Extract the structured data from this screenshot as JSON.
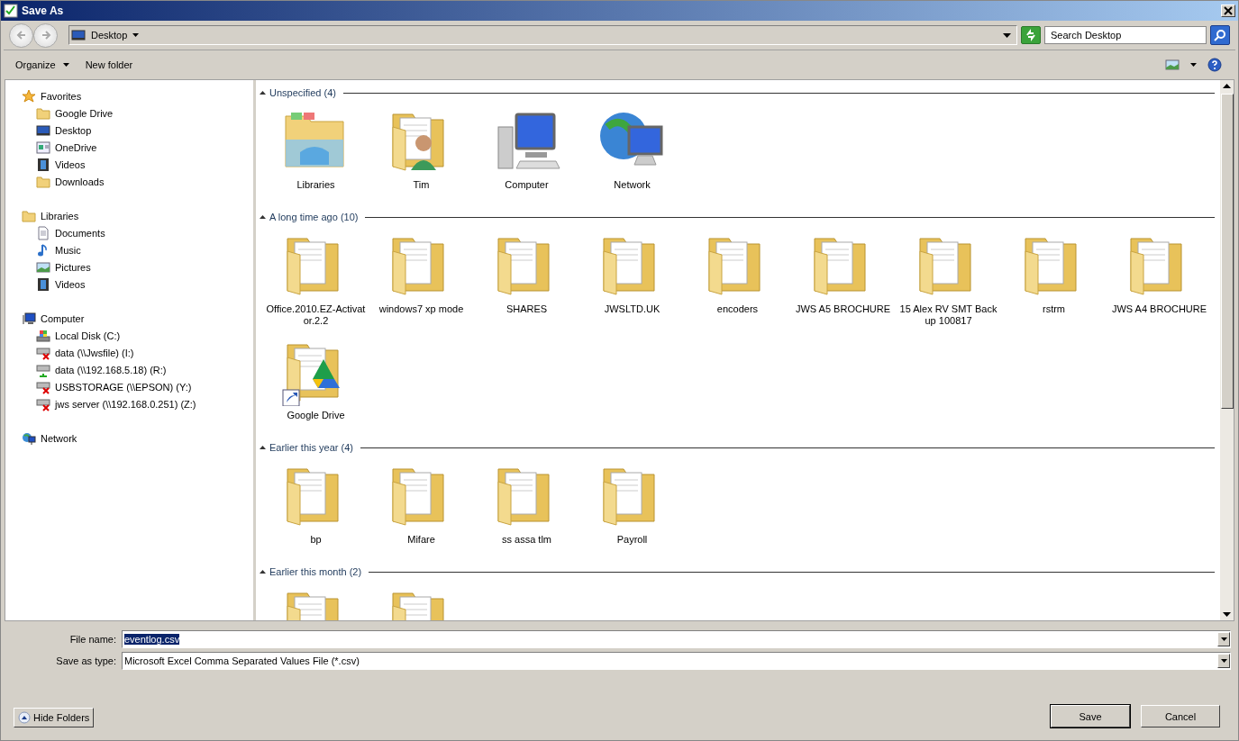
{
  "window": {
    "title": "Save As"
  },
  "address": {
    "location": "Desktop"
  },
  "search": {
    "placeholder": "Search Desktop"
  },
  "toolbar": {
    "organize": "Organize",
    "new_folder": "New folder"
  },
  "sidebar": {
    "groups": [
      {
        "label": "Favorites",
        "kind": "star",
        "children": [
          {
            "label": "Google Drive",
            "kind": "folder"
          },
          {
            "label": "Desktop",
            "kind": "monitor"
          },
          {
            "label": "OneDrive",
            "kind": "window"
          },
          {
            "label": "Videos",
            "kind": "film"
          },
          {
            "label": "Downloads",
            "kind": "folder"
          }
        ]
      },
      {
        "label": "Libraries",
        "kind": "folder",
        "children": [
          {
            "label": "Documents",
            "kind": "doc"
          },
          {
            "label": "Music",
            "kind": "music"
          },
          {
            "label": "Pictures",
            "kind": "picture"
          },
          {
            "label": "Videos",
            "kind": "film"
          }
        ]
      },
      {
        "label": "Computer",
        "kind": "computer",
        "children": [
          {
            "label": "Local Disk (C:)",
            "kind": "disk"
          },
          {
            "label": "data (\\\\Jwsfile) (I:)",
            "kind": "netdrive",
            "disconnected": true
          },
          {
            "label": "data (\\\\192.168.5.18) (R:)",
            "kind": "netdrive",
            "disconnected": false
          },
          {
            "label": "USBSTORAGE (\\\\EPSON) (Y:)",
            "kind": "netdrive",
            "disconnected": true
          },
          {
            "label": "jws server (\\\\192.168.0.251) (Z:)",
            "kind": "netdrive",
            "disconnected": true
          }
        ]
      },
      {
        "label": "Network",
        "kind": "network"
      }
    ]
  },
  "groups": [
    {
      "header": "Unspecified (4)",
      "items": [
        {
          "label": "Libraries",
          "kind": "libraries"
        },
        {
          "label": "Tim",
          "kind": "user"
        },
        {
          "label": "Computer",
          "kind": "computer"
        },
        {
          "label": "Network",
          "kind": "network"
        }
      ]
    },
    {
      "header": "A long time ago (10)",
      "items": [
        {
          "label": "Office.2010.EZ-Activator.2.2",
          "kind": "folder"
        },
        {
          "label": "windows7 xp mode",
          "kind": "folder"
        },
        {
          "label": "SHARES",
          "kind": "folder"
        },
        {
          "label": "JWSLTD.UK",
          "kind": "folder"
        },
        {
          "label": "encoders",
          "kind": "folder"
        },
        {
          "label": "JWS A5 BROCHURE",
          "kind": "folder"
        },
        {
          "label": "15 Alex RV SMT Backup 100817",
          "kind": "folder"
        },
        {
          "label": "rstrm",
          "kind": "folder"
        },
        {
          "label": "JWS A4 BROCHURE",
          "kind": "folder"
        },
        {
          "label": "Google Drive",
          "kind": "shortcut"
        }
      ]
    },
    {
      "header": "Earlier this year (4)",
      "items": [
        {
          "label": "bp",
          "kind": "folder"
        },
        {
          "label": "Mifare",
          "kind": "folder"
        },
        {
          "label": "ss assa tlm",
          "kind": "folder"
        },
        {
          "label": "Payroll",
          "kind": "folder"
        }
      ]
    },
    {
      "header": "Earlier this month (2)",
      "items": [
        {
          "kind": "folder"
        },
        {
          "kind": "folder"
        }
      ]
    }
  ],
  "form": {
    "file_name_label": "File name:",
    "file_name": "eventlog.csv",
    "type_label": "Save as type:",
    "type": "Microsoft Excel Comma Separated Values File (*.csv)"
  },
  "buttons": {
    "hide_folders": "Hide Folders",
    "save": "Save",
    "cancel": "Cancel"
  }
}
